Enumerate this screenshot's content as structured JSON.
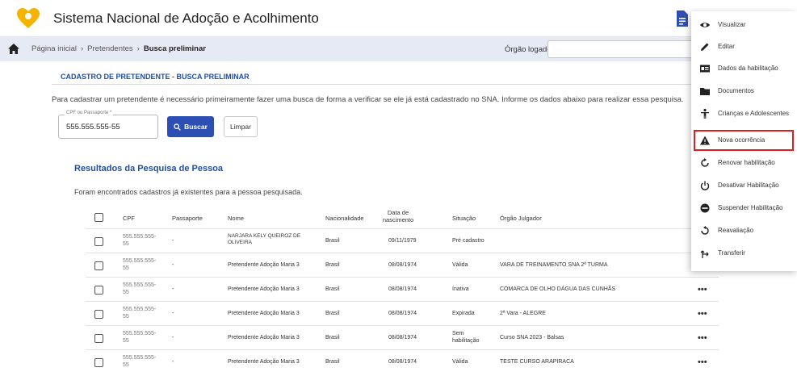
{
  "header": {
    "app_title": "Sistema Nacional de Adoção e Acolhimento",
    "logo_icon": "heart-pin-logo",
    "document_icon": "document-icon",
    "brand_color": "#f5b400"
  },
  "breadcrumb": {
    "home_icon": "home-icon",
    "items": [
      "Página inicial",
      "Pretendentes",
      "Busca preliminar"
    ],
    "separator": "›",
    "orgao_label": "Órgão logado"
  },
  "main": {
    "section_title": "CADASTRO DE PRETENDENTE - BUSCA PRELIMINAR",
    "intro_text": "Para cadastrar um pretendente é necessário primeiramente fazer uma busca de forma a verificar se ele já está cadastrado no SNA. Informe os dados abaixo para realizar essa pesquisa.",
    "cpf_field": {
      "label": "CPF ou Passaporte *",
      "value": "555.555.555-55"
    },
    "search_button": "Buscar",
    "clear_button": "Limpar",
    "accent_color": "#2d4fb3"
  },
  "results": {
    "title": "Resultados da Pesquisa de Pessoa",
    "subtitle": "Foram encontrados cadastros já existentes para a pessoa pesquisada.",
    "columns": [
      "CPF",
      "Passaporte",
      "Nome",
      "Nacionalidade",
      "Data de nascimento",
      "Situação",
      "Órgão Julgador"
    ],
    "rows": [
      {
        "cpf": "555.555.555-55",
        "passaporte": "-",
        "nome": "NARJARA KELY QUEIROZ DE OLIVEIRA",
        "nacionalidade": "Brasil",
        "nascimento": "09/11/1979",
        "situacao": "Pré cadastro",
        "orgao": ""
      },
      {
        "cpf": "555.555.555-55",
        "passaporte": "-",
        "nome": "Pretendente Adoção Maria 3",
        "nacionalidade": "Brasil",
        "nascimento": "08/08/1974",
        "situacao": "Válida",
        "orgao": "VARA DE TREINAMENTO SNA 2ª TURMA"
      },
      {
        "cpf": "555.555.555-55",
        "passaporte": "-",
        "nome": "Pretendente Adoção Maria 3",
        "nacionalidade": "Brasil",
        "nascimento": "08/08/1974",
        "situacao": "Inativa",
        "orgao": "COMARCA DE OLHO DÁGUA DAS CUNHÃS"
      },
      {
        "cpf": "555.555.555-55",
        "passaporte": "-",
        "nome": "Pretendente Adoção Maria 3",
        "nacionalidade": "Brasil",
        "nascimento": "08/08/1974",
        "situacao": "Expirada",
        "orgao": "2ª Vara - ALEGRE"
      },
      {
        "cpf": "555.555.555-55",
        "passaporte": "-",
        "nome": "Pretendente Adoção Maria 3",
        "nacionalidade": "Brasil",
        "nascimento": "08/08/1974",
        "situacao": "Sem habilitação",
        "orgao": "Curso SNA 2023 - Balsas"
      },
      {
        "cpf": "555.555.555-55",
        "passaporte": "-",
        "nome": "Pretendente Adoção Maria 3",
        "nacionalidade": "Brasil",
        "nascimento": "08/08/1974",
        "situacao": "Válida",
        "orgao": "TESTE CURSO ARAPIRACA"
      }
    ],
    "more_actions": "•••"
  },
  "context_menu": {
    "items": [
      {
        "label": "Visualizar",
        "icon": "eye-icon"
      },
      {
        "label": "Editar",
        "icon": "pencil-icon"
      },
      {
        "label": "Dados da habilitação",
        "icon": "id-card-icon"
      },
      {
        "label": "Documentos",
        "icon": "folder-icon"
      },
      {
        "label": "Crianças e Adolescentes",
        "icon": "child-icon"
      },
      {
        "label": "Nova ocorrência",
        "icon": "warning-icon"
      },
      {
        "label": "Renovar habilitação",
        "icon": "refresh-icon"
      },
      {
        "label": "Desativar Habilitação",
        "icon": "power-icon"
      },
      {
        "label": "Suspender Habilitação",
        "icon": "block-icon"
      },
      {
        "label": "Reavaliação",
        "icon": "undo-icon"
      },
      {
        "label": "Transferir",
        "icon": "transfer-icon"
      }
    ],
    "highlight_color": "#e01e1e"
  }
}
